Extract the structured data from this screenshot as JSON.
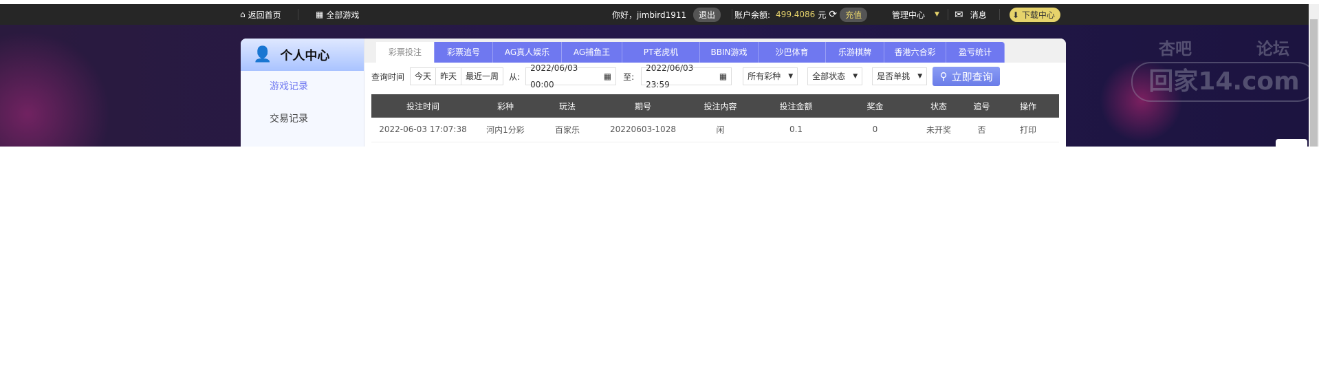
{
  "topbar": {
    "home": "返回首页",
    "all_games": "全部游戏",
    "greeting": "你好，jimbird1911",
    "logout": "退出",
    "balance_label": "账户余额:",
    "balance": "499.4086",
    "currency": "元",
    "recharge": "充值",
    "admin": "管理中心",
    "messages": "消息",
    "download": "下载中心"
  },
  "sidebar": {
    "title": "个人中心",
    "items": [
      {
        "label": "游戏记录"
      },
      {
        "label": "交易记录"
      }
    ]
  },
  "tabs": [
    {
      "label": "彩票投注"
    },
    {
      "label": "彩票追号"
    },
    {
      "label": "AG真人娱乐"
    },
    {
      "label": "AG捕鱼王"
    },
    {
      "label": "PT老虎机"
    },
    {
      "label": "BBIN游戏"
    },
    {
      "label": "沙巴体育"
    },
    {
      "label": "乐游棋牌"
    },
    {
      "label": "香港六合彩"
    },
    {
      "label": "盈亏统计"
    }
  ],
  "filter": {
    "label": "查询时间",
    "today": "今天",
    "yesterday": "昨天",
    "week": "最近一周",
    "from_label": "从:",
    "from": "2022/06/03 00:00",
    "to_label": "至:",
    "to": "2022/06/03 23:59",
    "lottery": "所有彩种",
    "status": "全部状态",
    "single": "是否单挑",
    "search": "立即查询"
  },
  "table": {
    "headers": [
      "投注时间",
      "彩种",
      "玩法",
      "期号",
      "投注内容",
      "投注金额",
      "奖金",
      "状态",
      "追号",
      "操作"
    ],
    "rows": [
      [
        "2022-06-03 17:07:38",
        "河内1分彩",
        "百家乐",
        "20220603-1028",
        "闲",
        "0.1",
        "0",
        "未开奖",
        "否",
        "打印"
      ]
    ]
  },
  "watermark": {
    "line1": "杏吧",
    "line2": "论坛",
    "line3": "回家14.com"
  },
  "colors": {
    "tab": "#6f78f0",
    "header": "#4a4a4a",
    "balance": "#e6d36b"
  }
}
